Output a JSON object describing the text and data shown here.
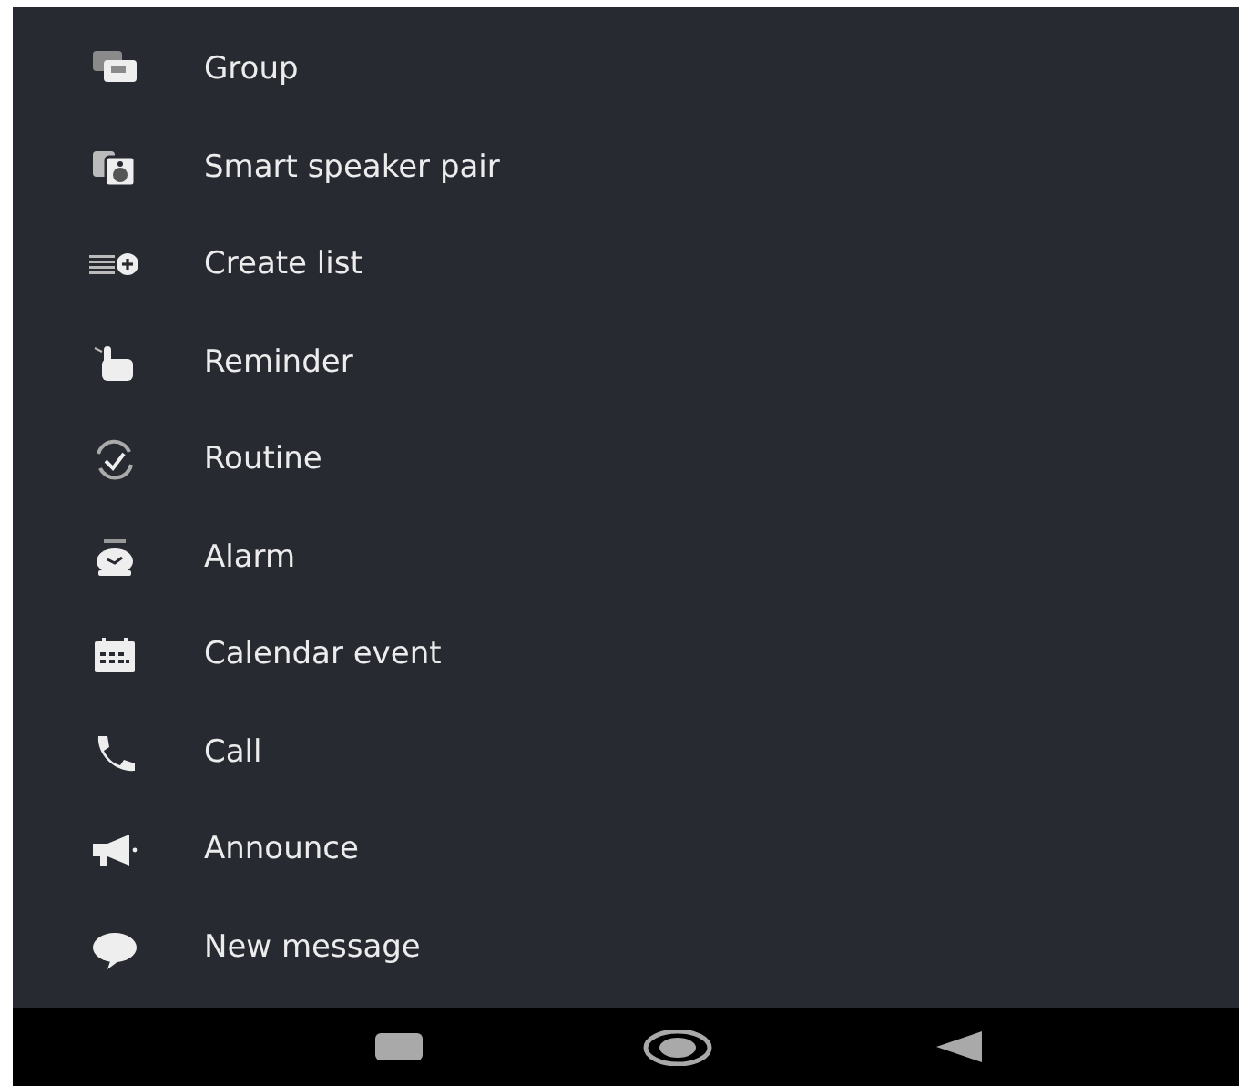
{
  "menu": {
    "items": [
      {
        "kind": "group",
        "label": "Group"
      },
      {
        "kind": "speaker",
        "label": "Smart speaker pair"
      },
      {
        "kind": "list",
        "label": "Create list"
      },
      {
        "kind": "reminder",
        "label": "Reminder"
      },
      {
        "kind": "routine",
        "label": "Routine"
      },
      {
        "kind": "alarm",
        "label": "Alarm"
      },
      {
        "kind": "calendar",
        "label": "Calendar event"
      },
      {
        "kind": "call",
        "label": "Call"
      },
      {
        "kind": "announce",
        "label": "Announce"
      },
      {
        "kind": "message",
        "label": "New message"
      }
    ]
  }
}
